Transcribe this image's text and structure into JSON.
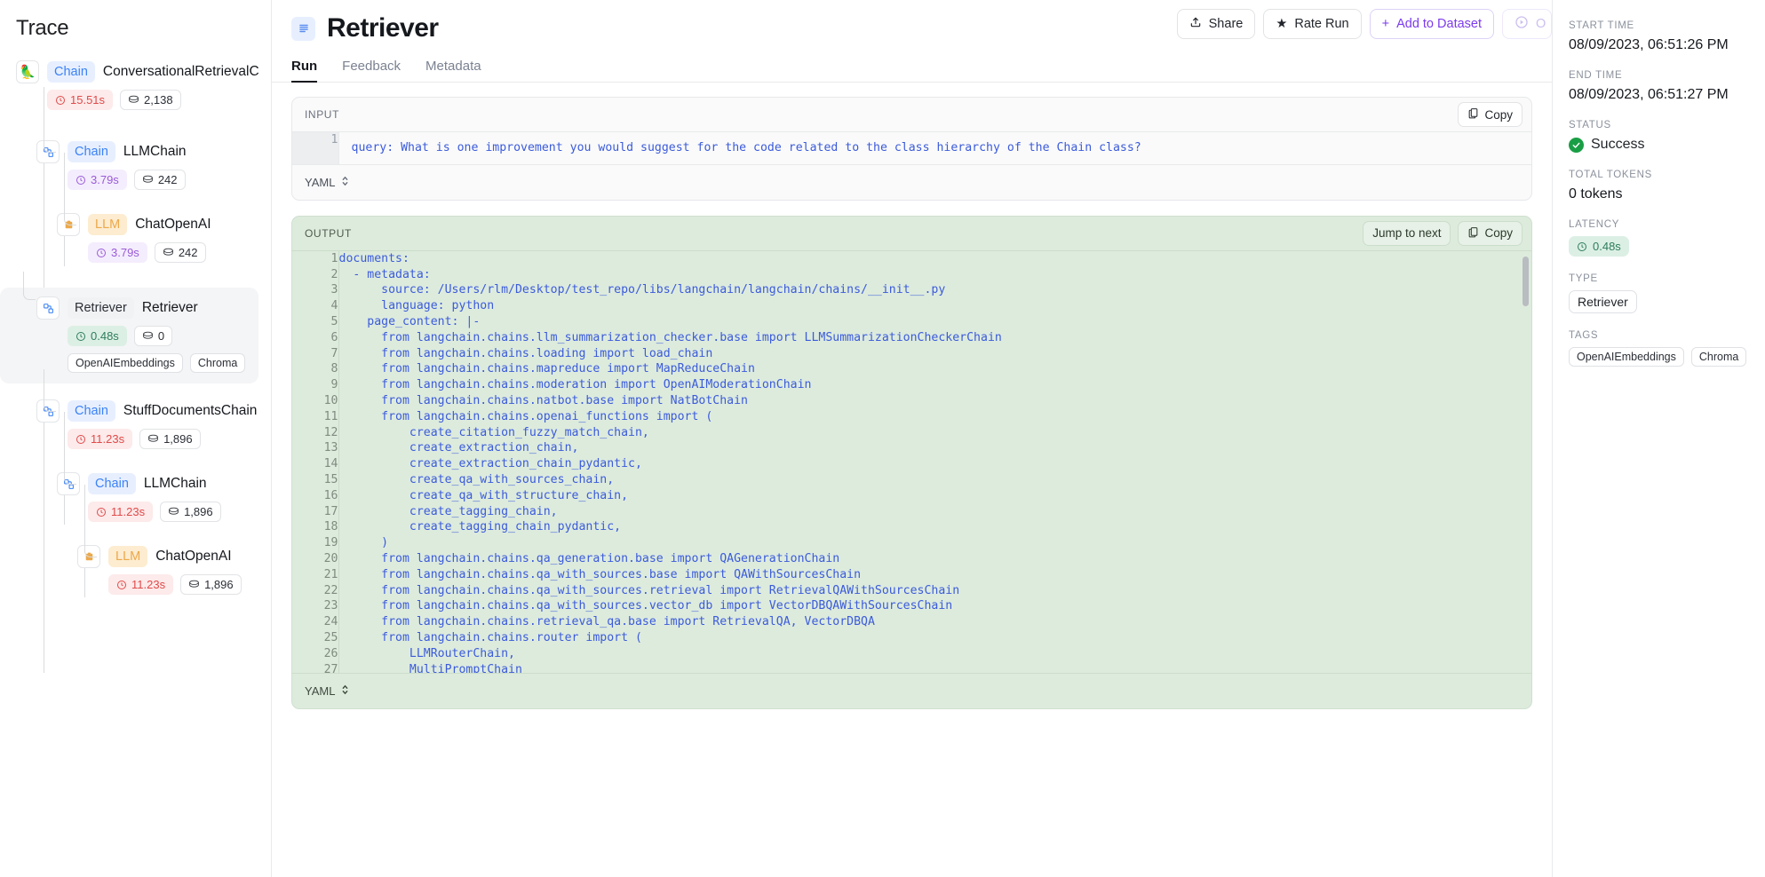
{
  "trace": {
    "title": "Trace",
    "nodes": [
      {
        "icon": "parrot-icon",
        "type_label": "Chain",
        "type_class": "chain",
        "name": "ConversationalRetrievalChain",
        "time": "15.51s",
        "time_class": "time-red",
        "tokens": "2,138",
        "tags": []
      },
      {
        "icon": "chain-node-icon",
        "type_label": "Chain",
        "type_class": "chain",
        "name": "LLMChain",
        "time": "3.79s",
        "time_class": "time-purple",
        "tokens": "242",
        "tags": []
      },
      {
        "icon": "llm-node-icon",
        "type_label": "LLM",
        "type_class": "llm",
        "name": "ChatOpenAI",
        "time": "3.79s",
        "time_class": "time-purple",
        "tokens": "242",
        "tags": []
      },
      {
        "icon": "chain-node-icon",
        "type_label": "Retriever",
        "type_class": "retr",
        "name": "Retriever",
        "time": "0.48s",
        "time_class": "time-green",
        "tokens": "0",
        "tags": [
          "OpenAIEmbeddings",
          "Chroma"
        ]
      },
      {
        "icon": "chain-node-icon",
        "type_label": "Chain",
        "type_class": "chain",
        "name": "StuffDocumentsChain",
        "time": "11.23s",
        "time_class": "time-red",
        "tokens": "1,896",
        "tags": []
      },
      {
        "icon": "chain-node-icon",
        "type_label": "Chain",
        "type_class": "chain",
        "name": "LLMChain",
        "time": "11.23s",
        "time_class": "time-red",
        "tokens": "1,896",
        "tags": []
      },
      {
        "icon": "llm-node-icon",
        "type_label": "LLM",
        "type_class": "llm",
        "name": "ChatOpenAI",
        "time": "11.23s",
        "time_class": "time-red",
        "tokens": "1,896",
        "tags": []
      }
    ]
  },
  "header": {
    "title": "Retriever",
    "icon": "list-lines-icon",
    "share_label": "Share",
    "rate_label": "Rate Run",
    "dataset_label": "Add to Dataset",
    "tabs": [
      {
        "label": "Run",
        "active": true
      },
      {
        "label": "Feedback",
        "active": false
      },
      {
        "label": "Metadata",
        "active": false
      }
    ]
  },
  "input_panel": {
    "label": "INPUT",
    "copy_label": "Copy",
    "format_label": "YAML",
    "lines": [
      {
        "n": "1",
        "text": "query: What is one improvement you would suggest for the code related to the class hierarchy of the Chain class?"
      }
    ]
  },
  "output_panel": {
    "label": "OUTPUT",
    "jump_label": "Jump to next",
    "copy_label": "Copy",
    "format_label": "YAML",
    "lines": [
      {
        "n": "1",
        "text": "documents:"
      },
      {
        "n": "2",
        "text": "  - metadata:"
      },
      {
        "n": "3",
        "text": "      source: /Users/rlm/Desktop/test_repo/libs/langchain/langchain/chains/__init__.py"
      },
      {
        "n": "4",
        "text": "      language: python"
      },
      {
        "n": "5",
        "text": "    page_content: |-"
      },
      {
        "n": "6",
        "text": "      from langchain.chains.llm_summarization_checker.base import LLMSummarizationCheckerChain"
      },
      {
        "n": "7",
        "text": "      from langchain.chains.loading import load_chain"
      },
      {
        "n": "8",
        "text": "      from langchain.chains.mapreduce import MapReduceChain"
      },
      {
        "n": "9",
        "text": "      from langchain.chains.moderation import OpenAIModerationChain"
      },
      {
        "n": "10",
        "text": "      from langchain.chains.natbot.base import NatBotChain"
      },
      {
        "n": "11",
        "text": "      from langchain.chains.openai_functions import ("
      },
      {
        "n": "12",
        "text": "          create_citation_fuzzy_match_chain,"
      },
      {
        "n": "13",
        "text": "          create_extraction_chain,"
      },
      {
        "n": "14",
        "text": "          create_extraction_chain_pydantic,"
      },
      {
        "n": "15",
        "text": "          create_qa_with_sources_chain,"
      },
      {
        "n": "16",
        "text": "          create_qa_with_structure_chain,"
      },
      {
        "n": "17",
        "text": "          create_tagging_chain,"
      },
      {
        "n": "18",
        "text": "          create_tagging_chain_pydantic,"
      },
      {
        "n": "19",
        "text": "      )"
      },
      {
        "n": "20",
        "text": "      from langchain.chains.qa_generation.base import QAGenerationChain"
      },
      {
        "n": "21",
        "text": "      from langchain.chains.qa_with_sources.base import QAWithSourcesChain"
      },
      {
        "n": "22",
        "text": "      from langchain.chains.qa_with_sources.retrieval import RetrievalQAWithSourcesChain"
      },
      {
        "n": "23",
        "text": "      from langchain.chains.qa_with_sources.vector_db import VectorDBQAWithSourcesChain"
      },
      {
        "n": "24",
        "text": "      from langchain.chains.retrieval_qa.base import RetrievalQA, VectorDBQA"
      },
      {
        "n": "25",
        "text": "      from langchain.chains.router import ("
      },
      {
        "n": "26",
        "text": "          LLMRouterChain,"
      },
      {
        "n": "27",
        "text": "          MultiPromptChain"
      }
    ]
  },
  "meta": {
    "start_time_label": "START TIME",
    "start_time": "08/09/2023, 06:51:26 PM",
    "end_time_label": "END TIME",
    "end_time": "08/09/2023, 06:51:27 PM",
    "status_label": "STATUS",
    "status": "Success",
    "tokens_label": "TOTAL TOKENS",
    "tokens": "0 tokens",
    "latency_label": "LATENCY",
    "latency": "0.48s",
    "type_label": "TYPE",
    "type": "Retriever",
    "tags_label": "TAGS",
    "tags": [
      "OpenAIEmbeddings",
      "Chroma"
    ]
  },
  "colors": {
    "accent_purple": "#7c3aed",
    "chain_blue": "#3b82f6",
    "llm_orange": "#eca94b",
    "error_red": "#e04a4a",
    "success_green": "#1a9e45",
    "output_bg": "#ddebdd"
  }
}
